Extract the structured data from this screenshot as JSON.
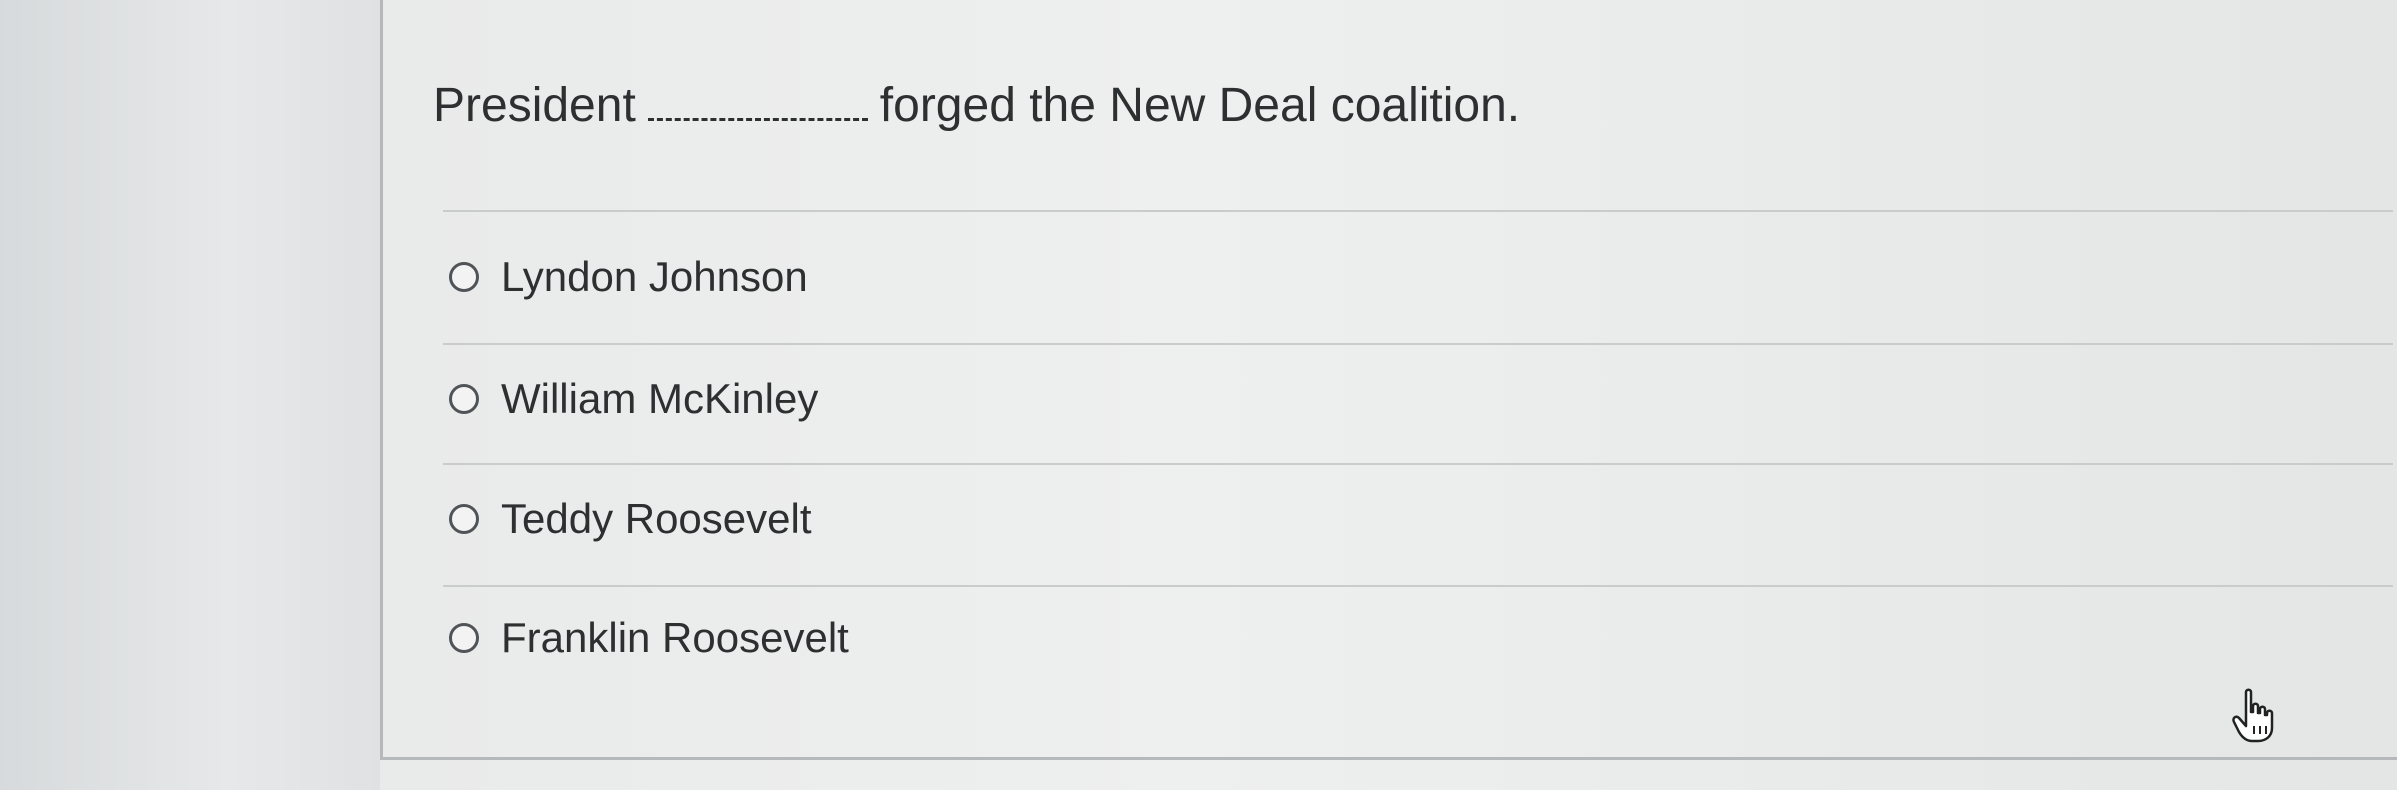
{
  "question": {
    "prefix": "President",
    "suffix": "forged the New Deal coalition."
  },
  "options": [
    {
      "label": "Lyndon Johnson",
      "selected": false
    },
    {
      "label": "William McKinley",
      "selected": false
    },
    {
      "label": "Teddy Roosevelt",
      "selected": false
    },
    {
      "label": "Franklin Roosevelt",
      "selected": false
    }
  ],
  "cursor": {
    "icon": "hand-pointer-icon"
  }
}
